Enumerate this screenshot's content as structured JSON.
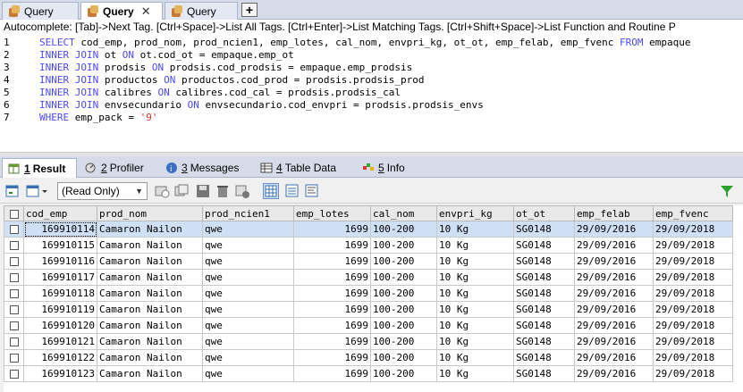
{
  "tabs": [
    {
      "label": "Query",
      "close": "",
      "active": false
    },
    {
      "label": "Query",
      "close": "✕",
      "active": true
    },
    {
      "label": "Query",
      "close": "",
      "active": false
    }
  ],
  "add_tab": "+",
  "autocomplete": "Autocomplete: [Tab]->Next Tag. [Ctrl+Space]->List All Tags. [Ctrl+Enter]->List Matching Tags. [Ctrl+Shift+Space]->List Function and Routine P",
  "editor": {
    "lines": [
      {
        "n": "1",
        "parts": [
          [
            "kw",
            "SELECT"
          ],
          [
            "t",
            " cod_emp, prod_nom, prod_ncien1, emp_lotes, cal_nom, envpri_kg, ot_ot, emp_felab, emp_fvenc "
          ],
          [
            "kw",
            "FROM"
          ],
          [
            "t",
            " empaque"
          ]
        ]
      },
      {
        "n": "2",
        "parts": [
          [
            "kw",
            "INNER JOIN"
          ],
          [
            "t",
            " ot "
          ],
          [
            "kw",
            "ON"
          ],
          [
            "t",
            " ot.cod_ot = empaque.emp_ot"
          ]
        ]
      },
      {
        "n": "3",
        "parts": [
          [
            "kw",
            "INNER JOIN"
          ],
          [
            "t",
            " prodsis "
          ],
          [
            "kw",
            "ON"
          ],
          [
            "t",
            " prodsis.cod_prodsis = empaque.emp_prodsis"
          ]
        ]
      },
      {
        "n": "4",
        "parts": [
          [
            "kw",
            "INNER JOIN"
          ],
          [
            "t",
            " productos "
          ],
          [
            "kw",
            "ON"
          ],
          [
            "t",
            " productos.cod_prod = prodsis.prodsis_prod"
          ]
        ]
      },
      {
        "n": "5",
        "parts": [
          [
            "kw",
            "INNER JOIN"
          ],
          [
            "t",
            " calibres "
          ],
          [
            "kw",
            "ON"
          ],
          [
            "t",
            " calibres.cod_cal = prodsis.prodsis_cal"
          ]
        ]
      },
      {
        "n": "6",
        "parts": [
          [
            "kw",
            "INNER JOIN"
          ],
          [
            "t",
            " envsecundario "
          ],
          [
            "kw",
            "ON"
          ],
          [
            "t",
            " envsecundario.cod_envpri = prodsis.prodsis_envs"
          ]
        ]
      },
      {
        "n": "7",
        "parts": [
          [
            "kw",
            "WHERE"
          ],
          [
            "t",
            " emp_pack = "
          ],
          [
            "str",
            "'9'"
          ]
        ]
      }
    ]
  },
  "result_tabs": [
    {
      "num": "1",
      "label": "Result",
      "active": true
    },
    {
      "num": "2",
      "label": "Profiler",
      "active": false
    },
    {
      "num": "3",
      "label": "Messages",
      "active": false
    },
    {
      "num": "4",
      "label": "Table Data",
      "active": false
    },
    {
      "num": "5",
      "label": "Info",
      "active": false
    }
  ],
  "toolbar": {
    "mode": "(Read Only)"
  },
  "grid": {
    "columns": [
      "cod_emp",
      "prod_nom",
      "prod_ncien1",
      "emp_lotes",
      "cal_nom",
      "envpri_kg",
      "ot_ot",
      "emp_felab",
      "emp_fvenc"
    ],
    "rows": [
      [
        "169910114",
        "Camaron Nailon",
        "qwe",
        "1699",
        "100-200",
        "10 Kg",
        "SG0148",
        "29/09/2016",
        "29/09/2018"
      ],
      [
        "169910115",
        "Camaron Nailon",
        "qwe",
        "1699",
        "100-200",
        "10 Kg",
        "SG0148",
        "29/09/2016",
        "29/09/2018"
      ],
      [
        "169910116",
        "Camaron Nailon",
        "qwe",
        "1699",
        "100-200",
        "10 Kg",
        "SG0148",
        "29/09/2016",
        "29/09/2018"
      ],
      [
        "169910117",
        "Camaron Nailon",
        "qwe",
        "1699",
        "100-200",
        "10 Kg",
        "SG0148",
        "29/09/2016",
        "29/09/2018"
      ],
      [
        "169910118",
        "Camaron Nailon",
        "qwe",
        "1699",
        "100-200",
        "10 Kg",
        "SG0148",
        "29/09/2016",
        "29/09/2018"
      ],
      [
        "169910119",
        "Camaron Nailon",
        "qwe",
        "1699",
        "100-200",
        "10 Kg",
        "SG0148",
        "29/09/2016",
        "29/09/2018"
      ],
      [
        "169910120",
        "Camaron Nailon",
        "qwe",
        "1699",
        "100-200",
        "10 Kg",
        "SG0148",
        "29/09/2016",
        "29/09/2018"
      ],
      [
        "169910121",
        "Camaron Nailon",
        "qwe",
        "1699",
        "100-200",
        "10 Kg",
        "SG0148",
        "29/09/2016",
        "29/09/2018"
      ],
      [
        "169910122",
        "Camaron Nailon",
        "qwe",
        "1699",
        "100-200",
        "10 Kg",
        "SG0148",
        "29/09/2016",
        "29/09/2018"
      ],
      [
        "169910123",
        "Camaron Nailon",
        "qwe",
        "1699",
        "100-200",
        "10 Kg",
        "SG0148",
        "29/09/2016",
        "29/09/2018"
      ]
    ]
  },
  "colors": {
    "keyword": "#4a4aff",
    "string": "#e0342b",
    "selected_row": "#cfe0f5"
  }
}
